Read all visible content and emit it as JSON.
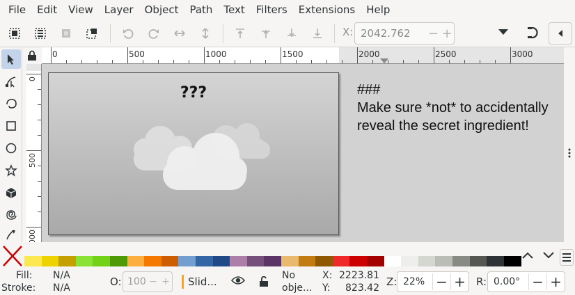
{
  "menu": [
    "File",
    "Edit",
    "View",
    "Layer",
    "Object",
    "Path",
    "Text",
    "Filters",
    "Extensions",
    "Help"
  ],
  "toolbar": {
    "x_label": "X:",
    "x_value": "2042.762",
    "icons": [
      "select-all-icon",
      "select-all-layers-icon",
      "deselect-icon",
      "select-same-icon",
      "undo-icon",
      "redo-icon",
      "flip-horizontal-icon",
      "flip-vertical-icon",
      "raise-to-top-icon",
      "raise-icon",
      "lower-icon",
      "lower-to-bottom-icon"
    ]
  },
  "tools": [
    "selector-tool",
    "node-tool",
    "tweak-tool",
    "rectangle-tool",
    "ellipse-tool",
    "star-tool",
    "3d-box-tool",
    "spiral-tool",
    "pencil-tool"
  ],
  "ruler": {
    "h_labels": [
      "0",
      "500",
      "1000",
      "1500",
      "2000",
      "2500",
      "3000"
    ],
    "v_labels": [
      "0",
      "500",
      "1000"
    ]
  },
  "canvas": {
    "page_title": "???",
    "note_lines": [
      "###",
      "Make sure *not* to accidentally",
      "reveal the secret ingredient!"
    ]
  },
  "palette": {
    "colors": [
      "#fce94f",
      "#edd400",
      "#c4a000",
      "#8ae234",
      "#73d216",
      "#4e9a06",
      "#fcaf3e",
      "#f57900",
      "#ce5c00",
      "#729fcf",
      "#3465a4",
      "#204a87",
      "#ad7fa8",
      "#75507b",
      "#5c3566",
      "#e9b96e",
      "#c17d11",
      "#8f5902",
      "#ef2929",
      "#cc0000",
      "#a40000",
      "#ffffff",
      "#eeeeec",
      "#d3d7cf",
      "#babdb6",
      "#888a85",
      "#555753",
      "#2e3436",
      "#000000"
    ]
  },
  "status": {
    "fill_label": "Fill:",
    "fill_value": "N/A",
    "stroke_label": "Stroke:",
    "stroke_value": "N/A",
    "opacity_label": "O:",
    "opacity_value": "100",
    "layer_name": "Slid...",
    "selection_line1": "No",
    "selection_line2": "obje...",
    "x_label": "X:",
    "x_value": "2223.81",
    "y_label": "Y:",
    "y_value": "823.42",
    "zoom_label": "Z:",
    "zoom_value": "22%",
    "rotate_label": "R:",
    "rotate_value": "0.00°"
  }
}
